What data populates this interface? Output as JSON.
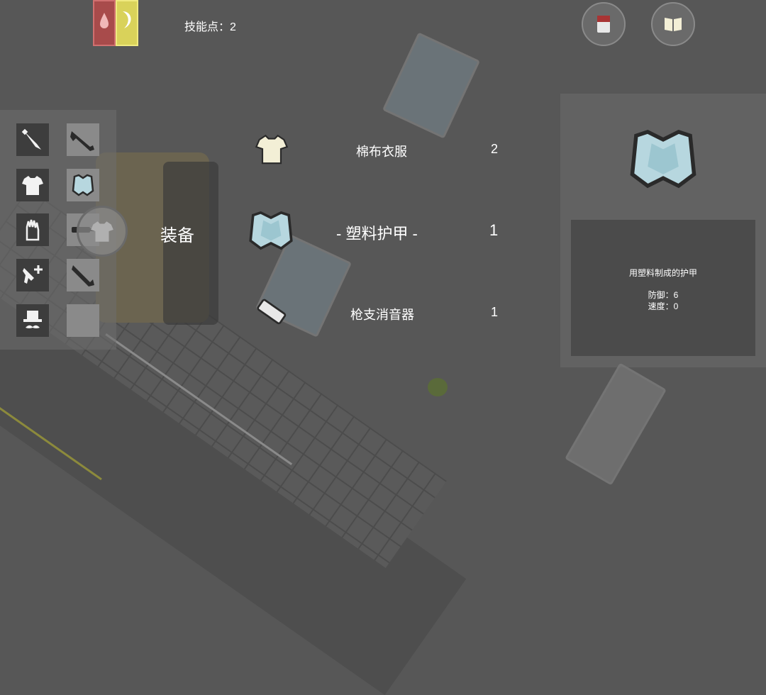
{
  "hud": {
    "skill_points": "技能点：2"
  },
  "side_label": "装备",
  "items": [
    {
      "name": "棉布衣服",
      "count": "2",
      "icon": "cotton-shirt-icon"
    },
    {
      "name": "- 塑料护甲 -",
      "count": "1",
      "icon": "plastic-armor-icon",
      "selected": true
    },
    {
      "name": "枪支消音器",
      "count": "1",
      "icon": "silencer-icon"
    }
  ],
  "detail": {
    "icon": "plastic-armor-icon",
    "description": "用塑料制成的护甲",
    "stat_defense": "防御：6",
    "stat_speed": "速度：0"
  },
  "sidebar_left": [
    "knife-icon",
    "shirt-icon",
    "glove-icon",
    "revolver-plus-icon",
    "hat-mustache-icon"
  ],
  "sidebar_right": [
    "rifle-icon",
    "armor-icon",
    "silencer-icon",
    "shotgun-icon",
    "empty-slot"
  ],
  "colors": {
    "health": "#a84b4b",
    "hunger": "#d9d25a",
    "background": "#575757"
  }
}
